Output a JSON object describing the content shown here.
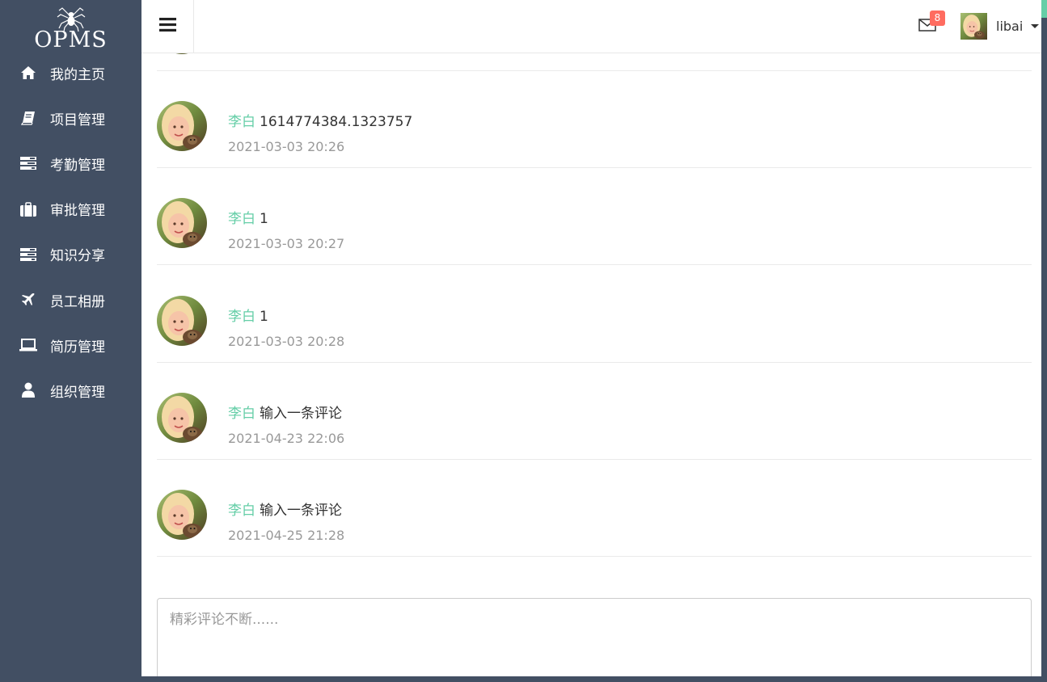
{
  "sidebar": {
    "logo_text": "OPMS",
    "items": [
      {
        "label": "我的主页",
        "icon": "home-icon"
      },
      {
        "label": "项目管理",
        "icon": "book-icon"
      },
      {
        "label": "考勤管理",
        "icon": "tasks-icon"
      },
      {
        "label": "审批管理",
        "icon": "briefcase-icon"
      },
      {
        "label": "知识分享",
        "icon": "tasks-icon"
      },
      {
        "label": "员工相册",
        "icon": "plane-icon"
      },
      {
        "label": "简历管理",
        "icon": "laptop-icon"
      },
      {
        "label": "组织管理",
        "icon": "user-icon"
      }
    ]
  },
  "header": {
    "unread_count": "8",
    "username": "libai"
  },
  "comments": [
    {
      "author": "李白",
      "text": "1614774384.1323757",
      "time": "2021-03-03 20:26"
    },
    {
      "author": "李白",
      "text": "1",
      "time": "2021-03-03 20:27"
    },
    {
      "author": "李白",
      "text": "1",
      "time": "2021-03-03 20:28"
    },
    {
      "author": "李白",
      "text": "输入一条评论",
      "time": "2021-04-23 22:06"
    },
    {
      "author": "李白",
      "text": "输入一条评论",
      "time": "2021-04-25 21:28"
    }
  ],
  "comment_box": {
    "placeholder": "精彩评论不断......"
  },
  "colors": {
    "sidebar_bg": "#424f63",
    "accent": "#65cea7",
    "badge": "#ff6c60"
  }
}
